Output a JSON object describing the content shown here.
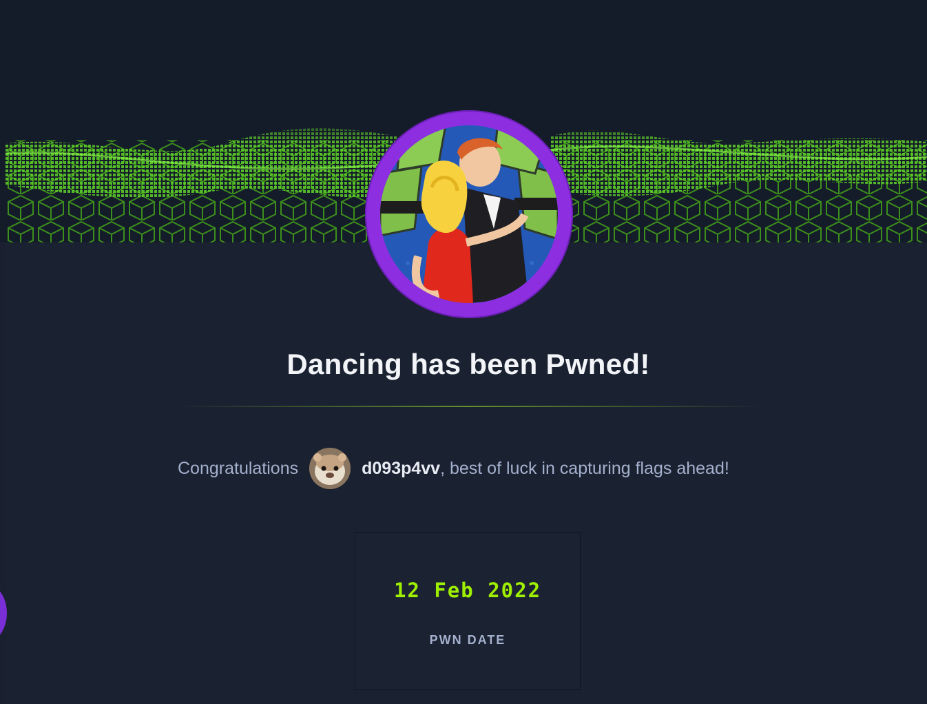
{
  "machine": {
    "name": "Dancing",
    "title": "Dancing has been Pwned!",
    "avatar_icon": "dancing-couple-icon"
  },
  "congrats": {
    "prefix": "Congratulations",
    "username": "d093p4vv",
    "suffix": ", best of luck in capturing flags ahead!",
    "avatar_icon": "hamster-avatar-icon"
  },
  "pwn": {
    "date": "12 Feb 2022",
    "label": "PWN DATE"
  },
  "colors": {
    "background": "#1a2030",
    "accent_green": "#9fef00",
    "ring_purple": "#8d2ee0",
    "text_muted": "#a4b1cd"
  }
}
